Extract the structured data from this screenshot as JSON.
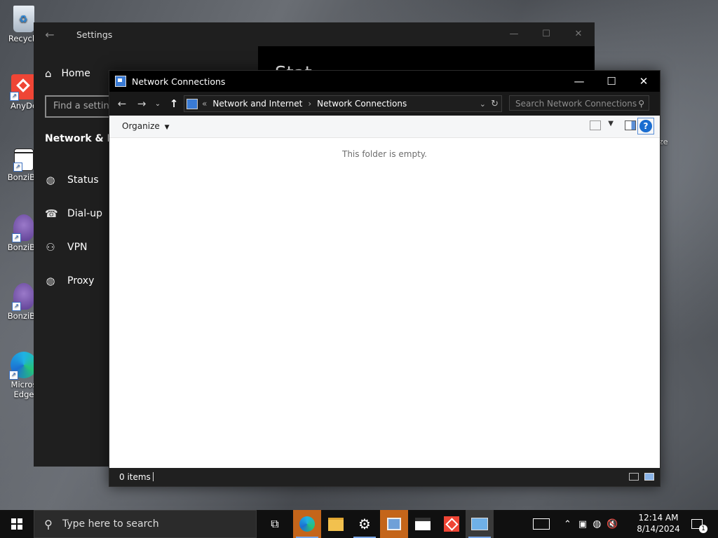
{
  "desktop": {
    "icons": [
      {
        "label": "Recycle",
        "icon": "recycle-bin-icon"
      },
      {
        "label": "AnyDe",
        "icon": "anydesk-icon"
      },
      {
        "label": "BonziBu",
        "icon": "bonzibuddy-file-icon"
      },
      {
        "label": "BonziBu",
        "icon": "bonzibuddy-icon"
      },
      {
        "label": "BonziBu",
        "icon": "bonzibuddy-icon"
      },
      {
        "label": "Micros\nEdge",
        "icon": "edge-icon"
      }
    ],
    "right_peek_label": "ze"
  },
  "settings": {
    "title": "Settings",
    "home_label": "Home",
    "search_placeholder": "Find a setting",
    "section_title": "Network & Inte",
    "nav": [
      {
        "label": "Status",
        "icon": "globe-icon"
      },
      {
        "label": "Dial-up",
        "icon": "dialup-icon"
      },
      {
        "label": "VPN",
        "icon": "vpn-icon"
      },
      {
        "label": "Proxy",
        "icon": "globe-icon"
      }
    ],
    "page_heading": "Stat"
  },
  "netwin": {
    "title": "Network Connections",
    "address": {
      "prefix": "«",
      "crumbs": [
        "Network and Internet",
        "Network Connections"
      ]
    },
    "search_placeholder": "Search Network Connections",
    "organize_label": "Organize",
    "empty_message": "This folder is empty.",
    "status_items": "0 items"
  },
  "taskbar": {
    "search_placeholder": "Type here to search",
    "clock_time": "12:14 AM",
    "clock_date": "8/14/2024",
    "notification_count": "1",
    "apps": [
      "task-view",
      "edge",
      "file-explorer",
      "settings",
      "control-panel",
      "clapperboard",
      "anydesk",
      "network-connections"
    ]
  },
  "colors": {
    "accent": "#1a6dd0",
    "taskbar": "#101010",
    "settings_bg": "#1f1f1f"
  }
}
